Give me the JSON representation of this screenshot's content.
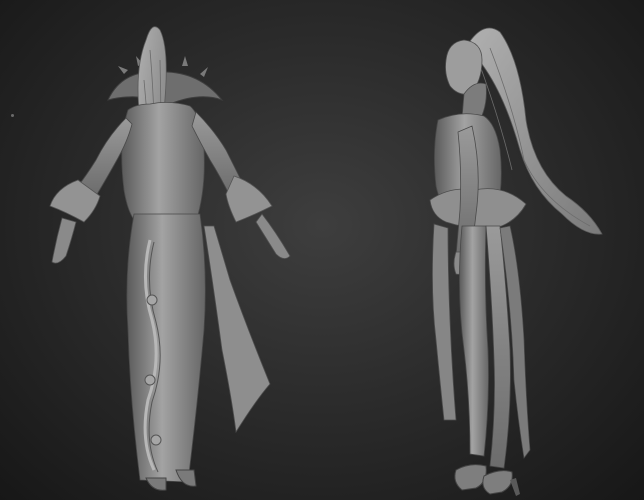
{
  "scene": {
    "background_color": "#2a2a2a",
    "model_color": "#8c8c8c",
    "highlight_color": "#b2b2b2",
    "shadow_color": "#4e4e4e"
  },
  "figures": [
    {
      "pose": "back-view"
    },
    {
      "pose": "side-view"
    }
  ]
}
